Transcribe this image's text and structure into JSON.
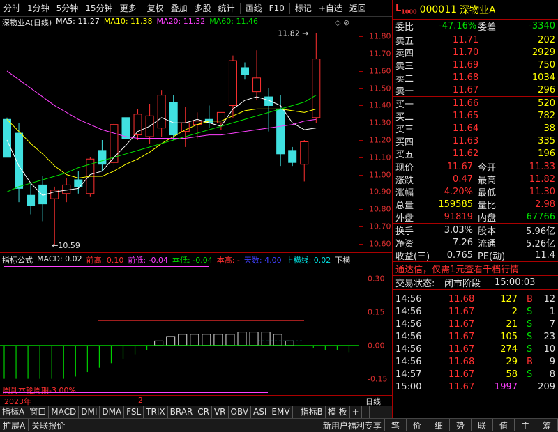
{
  "toolbar": {
    "items": [
      "分时",
      "1分钟",
      "5分钟",
      "15分钟",
      "更多",
      "复权",
      "叠加",
      "多股",
      "统计",
      "画线",
      "F10",
      "标记",
      "+自选",
      "返回"
    ]
  },
  "chart": {
    "stock_label": "深物业A(日线)",
    "ma": [
      {
        "label": "MA5: 11.27",
        "color": "#ffffff"
      },
      {
        "label": "MA10: 11.38",
        "color": "#ffff00"
      },
      {
        "label": "MA20: 11.32",
        "color": "#ff40ff"
      },
      {
        "label": "MA60: 11.46",
        "color": "#00e000"
      }
    ],
    "high_mark": "11.82",
    "low_mark": "10.59",
    "price_ticks": [
      "11.80",
      "11.70",
      "11.60",
      "11.50",
      "11.40",
      "11.30",
      "11.20",
      "11.10",
      "11.00",
      "10.90",
      "10.80",
      "10.70",
      "10.60"
    ]
  },
  "chart_data": {
    "type": "candlestick",
    "ylim": [
      10.55,
      11.85
    ],
    "candles": [
      {
        "o": 11.32,
        "h": 11.33,
        "l": 11.1,
        "c": 11.1,
        "up": false
      },
      {
        "o": 11.24,
        "h": 11.3,
        "l": 10.84,
        "c": 10.92,
        "up": false
      },
      {
        "o": 10.88,
        "h": 10.95,
        "l": 10.77,
        "c": 10.82,
        "up": false
      },
      {
        "o": 10.94,
        "h": 10.99,
        "l": 10.73,
        "c": 10.83,
        "up": false
      },
      {
        "o": 10.86,
        "h": 10.93,
        "l": 10.59,
        "c": 10.91,
        "up": true
      },
      {
        "o": 10.89,
        "h": 10.98,
        "l": 10.84,
        "c": 10.94,
        "up": true
      },
      {
        "o": 10.93,
        "h": 11.02,
        "l": 10.89,
        "c": 10.97,
        "up": false
      },
      {
        "o": 10.89,
        "h": 11.1,
        "l": 10.87,
        "c": 11.09,
        "up": true
      },
      {
        "o": 11.06,
        "h": 11.2,
        "l": 11.02,
        "c": 11.14,
        "up": false
      },
      {
        "o": 11.07,
        "h": 11.3,
        "l": 11.03,
        "c": 11.29,
        "up": true
      },
      {
        "o": 11.33,
        "h": 11.38,
        "l": 11.19,
        "c": 11.21,
        "up": false
      },
      {
        "o": 11.23,
        "h": 11.38,
        "l": 11.2,
        "c": 11.35,
        "up": true
      },
      {
        "o": 11.34,
        "h": 11.41,
        "l": 11.18,
        "c": 11.22,
        "up": true
      },
      {
        "o": 11.27,
        "h": 11.49,
        "l": 11.22,
        "c": 11.46,
        "up": true
      },
      {
        "o": 11.42,
        "h": 11.46,
        "l": 11.2,
        "c": 11.23,
        "up": false
      },
      {
        "o": 11.25,
        "h": 11.39,
        "l": 11.16,
        "c": 11.3,
        "up": true
      },
      {
        "o": 11.29,
        "h": 11.36,
        "l": 11.21,
        "c": 11.31,
        "up": true
      },
      {
        "o": 11.32,
        "h": 11.4,
        "l": 11.27,
        "c": 11.3,
        "up": false
      },
      {
        "o": 11.3,
        "h": 11.36,
        "l": 11.26,
        "c": 11.36,
        "up": true
      },
      {
        "o": 11.4,
        "h": 11.69,
        "l": 11.33,
        "c": 11.66,
        "up": true
      },
      {
        "o": 11.62,
        "h": 11.65,
        "l": 11.55,
        "c": 11.58,
        "up": false
      },
      {
        "o": 11.48,
        "h": 11.72,
        "l": 11.43,
        "c": 11.56,
        "up": true
      },
      {
        "o": 11.45,
        "h": 11.5,
        "l": 11.25,
        "c": 11.4,
        "up": false
      },
      {
        "o": 11.38,
        "h": 11.46,
        "l": 11.05,
        "c": 11.12,
        "up": false
      },
      {
        "o": 11.14,
        "h": 11.16,
        "l": 11.05,
        "c": 11.07,
        "up": false
      },
      {
        "o": 11.06,
        "h": 11.2,
        "l": 10.96,
        "c": 11.19,
        "up": true
      },
      {
        "o": 11.33,
        "h": 11.82,
        "l": 11.3,
        "c": 11.67,
        "up": true
      }
    ],
    "ma5": [
      11.2,
      11.05,
      10.95,
      10.88,
      10.9,
      10.91,
      10.92,
      11.0,
      11.02,
      11.1,
      11.17,
      11.25,
      11.28,
      11.33,
      11.3,
      11.3,
      11.32,
      11.3,
      11.28,
      11.38,
      11.43,
      11.45,
      11.43,
      11.4,
      11.3,
      11.26,
      11.27
    ],
    "ma10": [
      11.32,
      11.25,
      11.18,
      11.12,
      11.05,
      11.0,
      10.98,
      10.99,
      10.99,
      11.02,
      11.06,
      11.09,
      11.13,
      11.18,
      11.22,
      11.26,
      11.29,
      11.31,
      11.31,
      11.34,
      11.37,
      11.38,
      11.38,
      11.38,
      11.37,
      11.36,
      11.38
    ],
    "ma20": [
      11.6,
      11.55,
      11.5,
      11.45,
      11.4,
      11.36,
      11.32,
      11.29,
      11.26,
      11.24,
      11.22,
      11.21,
      11.21,
      11.21,
      11.21,
      11.21,
      11.22,
      11.23,
      11.23,
      11.24,
      11.25,
      11.26,
      11.27,
      11.28,
      11.29,
      11.31,
      11.32
    ],
    "ma60": [
      10.9,
      10.93,
      10.95,
      10.97,
      10.99,
      11.01,
      11.04,
      11.06,
      11.08,
      11.1,
      11.12,
      11.14,
      11.16,
      11.18,
      11.2,
      11.22,
      11.24,
      11.26,
      11.28,
      11.3,
      11.32,
      11.34,
      11.36,
      11.38,
      11.4,
      11.42,
      11.46
    ],
    "macd_ylim": [
      -0.22,
      0.35
    ],
    "macd_bars": [
      -0.15,
      -0.15,
      -0.15,
      -0.15,
      -0.15,
      -0.15,
      -0.14,
      -0.12,
      -0.1,
      -0.08,
      -0.06,
      -0.04,
      -0.02,
      0.02,
      0.04,
      0.05,
      0.05,
      0.05,
      0.05,
      0.05,
      0.06,
      0.06,
      0.06,
      0.05,
      0.02,
      0.0,
      -0.01,
      -0.02,
      -0.02,
      -0.03,
      -0.02,
      -0.02
    ]
  },
  "indicator": {
    "title": "指标公式",
    "macd": "MACD: 0.02",
    "qiangao": "前高: 0.10",
    "qiandi": "前低: -0.04",
    "bendi": "本低: -0.04",
    "bengao": "本高: -",
    "tianshu": "天数: 4.00",
    "hengxian": "上横线: 0.02",
    "xia": "下横",
    "ticks": [
      "0.30",
      "0.15",
      "0.00",
      "-0.15"
    ],
    "footer": "周到本轮周期-3.00%"
  },
  "date": {
    "year": "2023年",
    "mark": "2",
    "right": "日线"
  },
  "tabs": [
    "指标A",
    "窗口",
    "MACD",
    "DMI",
    "DMA",
    "FSL",
    "TRIX",
    "BRAR",
    "CR",
    "VR",
    "OBV",
    "ASI",
    "EMV",
    "指标B",
    "模 板",
    "+",
    "-"
  ],
  "bottom": {
    "left": [
      "扩展A",
      "关联报价"
    ],
    "promo": "新用户福利专享",
    "icons": [
      "笔",
      "价",
      "细",
      "势",
      "联",
      "值",
      "主",
      "筹"
    ]
  },
  "quote": {
    "code": "000011",
    "name": "深物业A",
    "weibi_label": "委比",
    "weibi": "-47.16%",
    "weicha_label": "委差",
    "weicha": "-3340",
    "sell": [
      {
        "label": "卖五",
        "price": "11.71",
        "vol": "202"
      },
      {
        "label": "卖四",
        "price": "11.70",
        "vol": "2929"
      },
      {
        "label": "卖三",
        "price": "11.69",
        "vol": "750"
      },
      {
        "label": "卖二",
        "price": "11.68",
        "vol": "1034"
      },
      {
        "label": "卖一",
        "price": "11.67",
        "vol": "296"
      }
    ],
    "buy": [
      {
        "label": "买一",
        "price": "11.66",
        "vol": "520"
      },
      {
        "label": "买二",
        "price": "11.65",
        "vol": "782"
      },
      {
        "label": "买三",
        "price": "11.64",
        "vol": "38"
      },
      {
        "label": "买四",
        "price": "11.63",
        "vol": "335"
      },
      {
        "label": "买五",
        "price": "11.62",
        "vol": "196"
      }
    ],
    "stats": [
      {
        "l1": "现价",
        "v1": "11.67",
        "l2": "今开",
        "v2": "11.33",
        "c1": "red",
        "c2": "red"
      },
      {
        "l1": "涨跌",
        "v1": "0.47",
        "l2": "最高",
        "v2": "11.82",
        "c1": "red",
        "c2": "red"
      },
      {
        "l1": "涨幅",
        "v1": "4.20%",
        "l2": "最低",
        "v2": "11.30",
        "c1": "red",
        "c2": "red"
      },
      {
        "l1": "总量",
        "v1": "159585",
        "l2": "量比",
        "v2": "2.98",
        "c1": "yellow",
        "c2": "red"
      },
      {
        "l1": "外盘",
        "v1": "91819",
        "l2": "内盘",
        "v2": "67766",
        "c1": "red",
        "c2": "green"
      }
    ],
    "stats2": [
      {
        "l1": "换手",
        "v1": "3.03%",
        "l2": "股本",
        "v2": "5.96亿"
      },
      {
        "l1": "净资",
        "v1": "7.26",
        "l2": "流通",
        "v2": "5.26亿"
      },
      {
        "l1": "收益(三)",
        "v1": "0.765",
        "l2": "PE(动)",
        "v2": "11.4"
      }
    ],
    "ad": "通达信，仅需1元查看千档行情",
    "status_label": "交易状态:",
    "status": "闭市阶段",
    "status_time": "15:00:03",
    "ticks": [
      {
        "t": "14:56",
        "p": "11.68",
        "v": "127",
        "d": "B",
        "n": "12"
      },
      {
        "t": "14:56",
        "p": "11.67",
        "v": "2",
        "d": "S",
        "n": "1"
      },
      {
        "t": "14:56",
        "p": "11.67",
        "v": "21",
        "d": "S",
        "n": "7"
      },
      {
        "t": "14:56",
        "p": "11.67",
        "v": "105",
        "d": "S",
        "n": "23"
      },
      {
        "t": "14:56",
        "p": "11.67",
        "v": "274",
        "d": "S",
        "n": "10"
      },
      {
        "t": "14:56",
        "p": "11.68",
        "v": "29",
        "d": "B",
        "n": "9"
      },
      {
        "t": "14:57",
        "p": "11.67",
        "v": "58",
        "d": "S",
        "n": "8"
      },
      {
        "t": "15:00",
        "p": "11.67",
        "v": "1997",
        "d": "",
        "n": "209"
      }
    ]
  }
}
